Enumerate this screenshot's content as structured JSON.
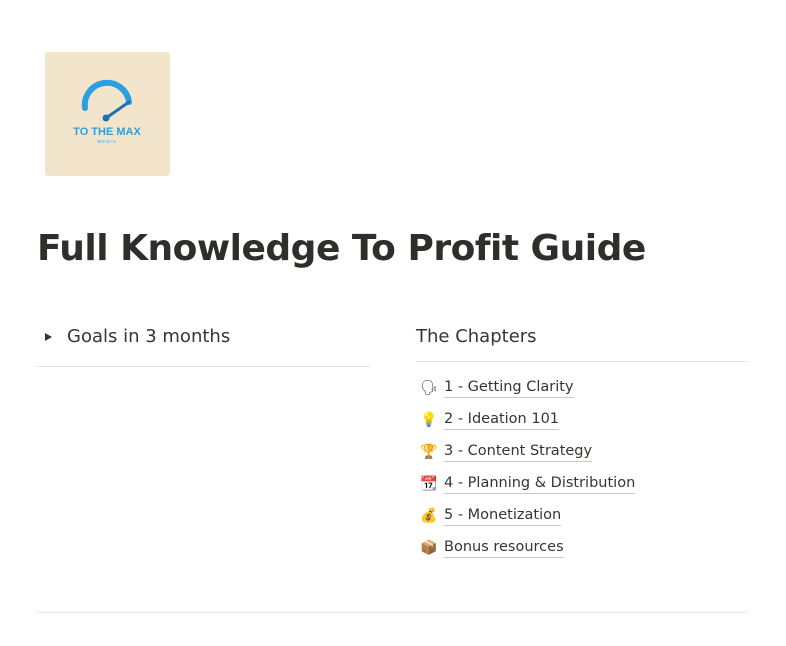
{
  "cover": {
    "logo_text": "TO THE MAX",
    "logo_subtext": "MEDIA",
    "background_color": "#f3e5cc",
    "accent_color": "#2b9fe0"
  },
  "page": {
    "title": "Full Knowledge To Profit Guide"
  },
  "toggle": {
    "label": "Goals in 3 months",
    "icon": "triangle-right-icon"
  },
  "chapters": {
    "heading": "The Chapters",
    "items": [
      {
        "icon": "🗣",
        "icon_name": "speaking-head-icon",
        "label": "1 - Getting Clarity"
      },
      {
        "icon": "💡",
        "icon_name": "light-bulb-icon",
        "label": "2 - Ideation 101"
      },
      {
        "icon": "🏆",
        "icon_name": "trophy-icon",
        "label": "3 - Content Strategy"
      },
      {
        "icon": "📆",
        "icon_name": "calendar-icon",
        "label": "4 - Planning & Distribution"
      },
      {
        "icon": "💰",
        "icon_name": "money-bag-icon",
        "label": "5 - Monetization"
      },
      {
        "icon": "📦",
        "icon_name": "package-icon",
        "label": "Bonus resources"
      }
    ]
  }
}
